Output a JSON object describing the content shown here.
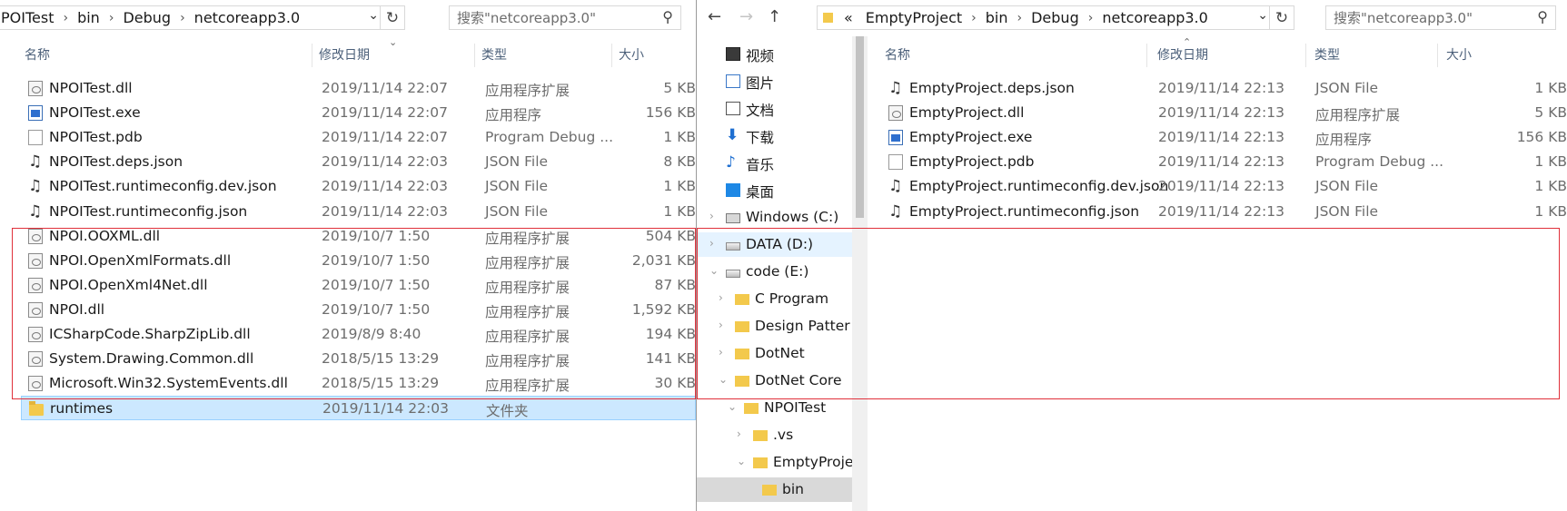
{
  "left": {
    "address": [
      "POITest",
      "bin",
      "Debug",
      "netcoreapp3.0"
    ],
    "search_placeholder": "搜索\"netcoreapp3.0\"",
    "columns": {
      "name": "名称",
      "date": "修改日期",
      "type": "类型",
      "size": "大小"
    },
    "files": [
      {
        "name": "NPOITest.dll",
        "date": "2019/11/14 22:07",
        "type": "应用程序扩展",
        "size": "5 KB",
        "icon": "dll"
      },
      {
        "name": "NPOITest.exe",
        "date": "2019/11/14 22:07",
        "type": "应用程序",
        "size": "156 KB",
        "icon": "exe"
      },
      {
        "name": "NPOITest.pdb",
        "date": "2019/11/14 22:07",
        "type": "Program Debug ...",
        "size": "1 KB",
        "icon": "pdb"
      },
      {
        "name": "NPOITest.deps.json",
        "date": "2019/11/14 22:03",
        "type": "JSON File",
        "size": "8 KB",
        "icon": "json"
      },
      {
        "name": "NPOITest.runtimeconfig.dev.json",
        "date": "2019/11/14 22:03",
        "type": "JSON File",
        "size": "1 KB",
        "icon": "json"
      },
      {
        "name": "NPOITest.runtimeconfig.json",
        "date": "2019/11/14 22:03",
        "type": "JSON File",
        "size": "1 KB",
        "icon": "json"
      },
      {
        "name": "NPOI.OOXML.dll",
        "date": "2019/10/7 1:50",
        "type": "应用程序扩展",
        "size": "504 KB",
        "icon": "dll"
      },
      {
        "name": "NPOI.OpenXmlFormats.dll",
        "date": "2019/10/7 1:50",
        "type": "应用程序扩展",
        "size": "2,031 KB",
        "icon": "dll"
      },
      {
        "name": "NPOI.OpenXml4Net.dll",
        "date": "2019/10/7 1:50",
        "type": "应用程序扩展",
        "size": "87 KB",
        "icon": "dll"
      },
      {
        "name": "NPOI.dll",
        "date": "2019/10/7 1:50",
        "type": "应用程序扩展",
        "size": "1,592 KB",
        "icon": "dll"
      },
      {
        "name": "ICSharpCode.SharpZipLib.dll",
        "date": "2019/8/9 8:40",
        "type": "应用程序扩展",
        "size": "194 KB",
        "icon": "dll"
      },
      {
        "name": "System.Drawing.Common.dll",
        "date": "2018/5/15 13:29",
        "type": "应用程序扩展",
        "size": "141 KB",
        "icon": "dll"
      },
      {
        "name": "Microsoft.Win32.SystemEvents.dll",
        "date": "2018/5/15 13:29",
        "type": "应用程序扩展",
        "size": "30 KB",
        "icon": "dll"
      },
      {
        "name": "runtimes",
        "date": "2019/11/14 22:03",
        "type": "文件夹",
        "size": "",
        "icon": "folder"
      }
    ]
  },
  "right": {
    "nav_buttons": {
      "back": "←",
      "forward": "→",
      "up": "↑"
    },
    "address": [
      "«",
      "EmptyProject",
      "bin",
      "Debug",
      "netcoreapp3.0"
    ],
    "search_placeholder": "搜索\"netcoreapp3.0\"",
    "columns": {
      "name": "名称",
      "date": "修改日期",
      "type": "类型",
      "size": "大小"
    },
    "nav_items": [
      {
        "label": "视频",
        "icon": "video"
      },
      {
        "label": "图片",
        "icon": "pic"
      },
      {
        "label": "文档",
        "icon": "doc"
      },
      {
        "label": "下载",
        "icon": "down"
      },
      {
        "label": "音乐",
        "icon": "music"
      },
      {
        "label": "桌面",
        "icon": "desk"
      },
      {
        "label": "Windows (C:)",
        "icon": "win"
      },
      {
        "label": "DATA (D:)",
        "icon": "drive"
      },
      {
        "label": "code (E:)",
        "icon": "drive"
      },
      {
        "label": "C Program",
        "icon": "folder"
      },
      {
        "label": "Design Patter",
        "icon": "folder"
      },
      {
        "label": "DotNet",
        "icon": "folder"
      },
      {
        "label": "DotNet Core",
        "icon": "folder"
      },
      {
        "label": "NPOITest",
        "icon": "folder"
      },
      {
        "label": ".vs",
        "icon": "folder"
      },
      {
        "label": "EmptyProje",
        "icon": "folder"
      },
      {
        "label": "bin",
        "icon": "folder"
      }
    ],
    "files": [
      {
        "name": "EmptyProject.deps.json",
        "date": "2019/11/14 22:13",
        "type": "JSON File",
        "size": "1 KB",
        "icon": "json"
      },
      {
        "name": "EmptyProject.dll",
        "date": "2019/11/14 22:13",
        "type": "应用程序扩展",
        "size": "5 KB",
        "icon": "dll"
      },
      {
        "name": "EmptyProject.exe",
        "date": "2019/11/14 22:13",
        "type": "应用程序",
        "size": "156 KB",
        "icon": "exe"
      },
      {
        "name": "EmptyProject.pdb",
        "date": "2019/11/14 22:13",
        "type": "Program Debug ...",
        "size": "1 KB",
        "icon": "pdb"
      },
      {
        "name": "EmptyProject.runtimeconfig.dev.json",
        "date": "2019/11/14 22:13",
        "type": "JSON File",
        "size": "1 KB",
        "icon": "json"
      },
      {
        "name": "EmptyProject.runtimeconfig.json",
        "date": "2019/11/14 22:13",
        "type": "JSON File",
        "size": "1 KB",
        "icon": "json"
      }
    ]
  },
  "colors": {
    "annotation_box": "#e0303a",
    "selection": "#cce8ff"
  }
}
